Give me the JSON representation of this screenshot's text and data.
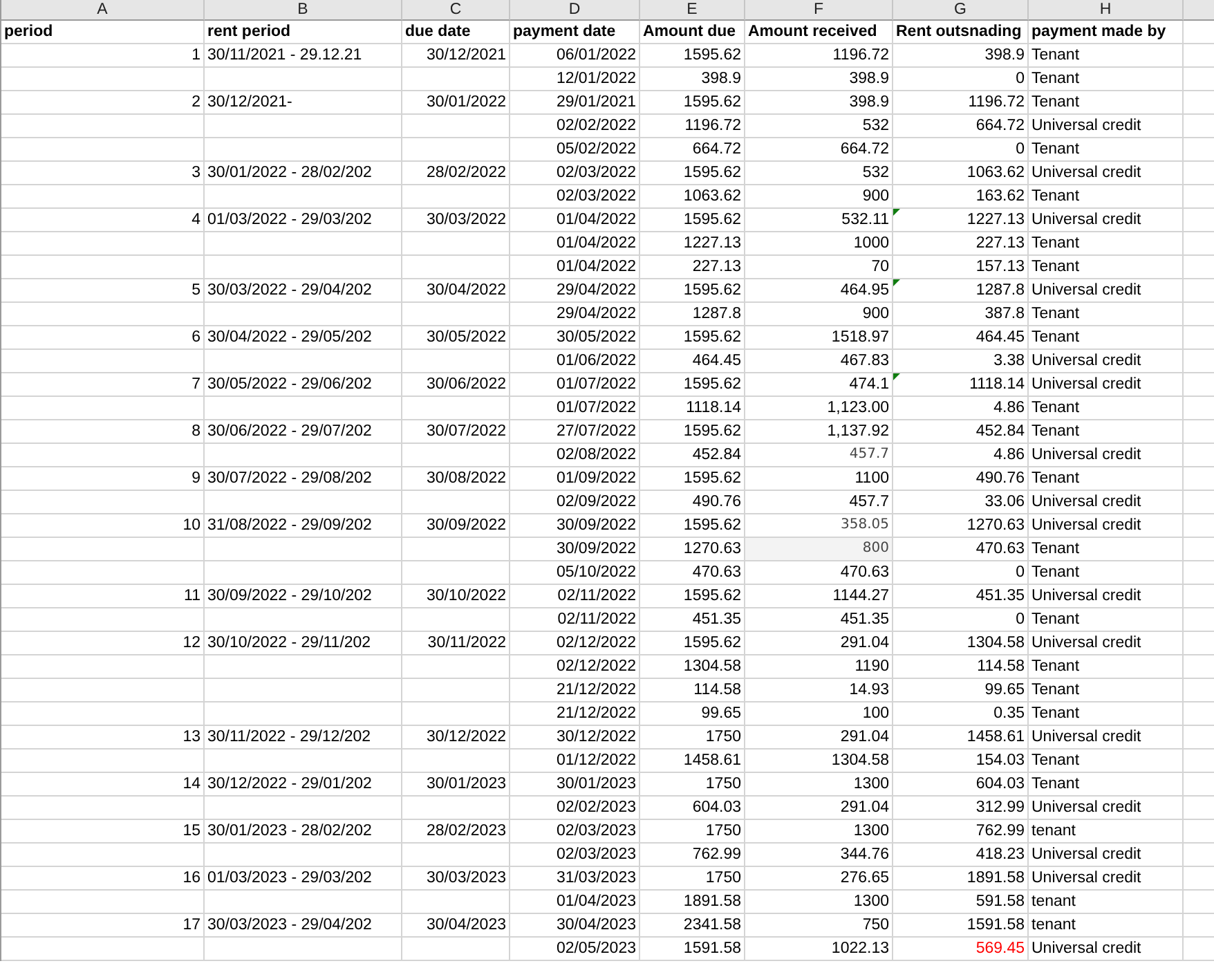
{
  "columns": [
    "A",
    "B",
    "C",
    "D",
    "E",
    "F",
    "G",
    "H"
  ],
  "headers": [
    "period",
    "rent period",
    "due date",
    "payment date",
    "Amount due",
    "Amount received",
    "Rent outsnading",
    "payment made by"
  ],
  "rows": [
    {
      "period": "1",
      "rent_period": "30/11/2021 - 29.12.21",
      "due_date": "30/12/2021",
      "payment_date": "06/01/2022",
      "amount_due": "1595.62",
      "amount_received": "1196.72",
      "outstanding": "398.9",
      "paid_by": "Tenant",
      "flagged": false
    },
    {
      "payment_date": "12/01/2022",
      "amount_due": "398.9",
      "amount_received": "398.9",
      "outstanding": "0",
      "paid_by": "Tenant",
      "flagged": false
    },
    {
      "period": "2",
      "rent_period": "30/12/2021-",
      "due_date": "30/01/2022",
      "payment_date": "29/01/2021",
      "amount_due": "1595.62",
      "amount_received": "398.9",
      "outstanding": "1196.72",
      "paid_by": "Tenant",
      "flagged": false
    },
    {
      "payment_date": "02/02/2022",
      "amount_due": "1196.72",
      "amount_received": "532",
      "outstanding": "664.72",
      "paid_by": "Universal credit",
      "flagged": false
    },
    {
      "payment_date": "05/02/2022",
      "amount_due": "664.72",
      "amount_received": "664.72",
      "outstanding": "0",
      "paid_by": "Tenant",
      "flagged": false
    },
    {
      "period": "3",
      "rent_period": "30/01/2022 - 28/02/202",
      "due_date": "28/02/2022",
      "payment_date": "02/03/2022",
      "amount_due": "1595.62",
      "amount_received": "532",
      "outstanding": "1063.62",
      "paid_by": "Universal credit",
      "flagged": false
    },
    {
      "payment_date": "02/03/2022",
      "amount_due": "1063.62",
      "amount_received": "900",
      "outstanding": "163.62",
      "paid_by": "Tenant",
      "flagged": false
    },
    {
      "period": "4",
      "rent_period": "01/03/2022 - 29/03/202",
      "due_date": "30/03/2022",
      "payment_date": "01/04/2022",
      "amount_due": "1595.62",
      "amount_received": "532.11",
      "outstanding": "1227.13",
      "paid_by": "Universal credit",
      "flagged": true
    },
    {
      "payment_date": "01/04/2022",
      "amount_due": "1227.13",
      "amount_received": "1000",
      "outstanding": "227.13",
      "paid_by": "Tenant",
      "flagged": false
    },
    {
      "payment_date": "01/04/2022",
      "amount_due": "227.13",
      "amount_received": "70",
      "outstanding": "157.13",
      "paid_by": "Tenant",
      "flagged": false
    },
    {
      "period": "5",
      "rent_period": "30/03/2022 - 29/04/202",
      "due_date": "30/04/2022",
      "payment_date": "29/04/2022",
      "amount_due": "1595.62",
      "amount_received": "464.95",
      "outstanding": "1287.8",
      "paid_by": "Universal credit",
      "flagged": true
    },
    {
      "payment_date": "29/04/2022",
      "amount_due": "1287.8",
      "amount_received": "900",
      "outstanding": "387.8",
      "paid_by": "Tenant",
      "flagged": false
    },
    {
      "period": "6",
      "rent_period": "30/04/2022 - 29/05/202",
      "due_date": "30/05/2022",
      "payment_date": "30/05/2022",
      "amount_due": "1595.62",
      "amount_received": "1518.97",
      "outstanding": "464.45",
      "paid_by": "Tenant",
      "flagged": false
    },
    {
      "payment_date": "01/06/2022",
      "amount_due": "464.45",
      "amount_received": "467.83",
      "outstanding": "3.38",
      "paid_by": "Universal credit",
      "flagged": false
    },
    {
      "period": "7",
      "rent_period": "30/05/2022 - 29/06/202",
      "due_date": "30/06/2022",
      "payment_date": "01/07/2022",
      "amount_due": "1595.62",
      "amount_received": "474.1",
      "outstanding": "1118.14",
      "paid_by": "Universal credit",
      "flagged": true
    },
    {
      "payment_date": "01/07/2022",
      "amount_due": "1118.14",
      "amount_received": "1,123.00",
      "outstanding": "4.86",
      "paid_by": "Tenant",
      "flagged": false
    },
    {
      "period": "8",
      "rent_period": "30/06/2022 - 29/07/202",
      "due_date": "30/07/2022",
      "payment_date": "27/07/2022",
      "amount_due": "1595.62",
      "amount_received": "1,137.92",
      "outstanding": "452.84",
      "paid_by": "Tenant",
      "flagged": false
    },
    {
      "payment_date": "02/08/2022",
      "amount_due": "452.84",
      "amount_received": "457.7",
      "received_plain": true,
      "outstanding": "4.86",
      "paid_by": "Universal credit",
      "flagged": false
    },
    {
      "period": "9",
      "rent_period": "30/07/2022 - 29/08/202",
      "due_date": "30/08/2022",
      "payment_date": "01/09/2022",
      "amount_due": "1595.62",
      "amount_received": "1100",
      "outstanding": "490.76",
      "paid_by": "Tenant",
      "flagged": false
    },
    {
      "payment_date": "02/09/2022",
      "amount_due": "490.76",
      "amount_received": "457.7",
      "outstanding": "33.06",
      "paid_by": "Universal credit",
      "flagged": false
    },
    {
      "period": "10",
      "rent_period": "31/08/2022 - 29/09/202",
      "due_date": "30/09/2022",
      "payment_date": "30/09/2022",
      "amount_due": "1595.62",
      "amount_received": "358.05",
      "received_plain": true,
      "outstanding": "1270.63",
      "paid_by": "Universal credit",
      "flagged": false
    },
    {
      "payment_date": "30/09/2022",
      "amount_due": "1270.63",
      "amount_received": "800",
      "received_plain": true,
      "received_shaded": true,
      "outstanding": "470.63",
      "paid_by": "Tenant",
      "flagged": false
    },
    {
      "payment_date": "05/10/2022",
      "amount_due": "470.63",
      "amount_received": "470.63",
      "outstanding": "0",
      "paid_by": "Tenant",
      "flagged": false
    },
    {
      "period": "11",
      "rent_period": "30/09/2022 - 29/10/202",
      "due_date": "30/10/2022",
      "payment_date": "02/11/2022",
      "amount_due": "1595.62",
      "amount_received": "1144.27",
      "outstanding": "451.35",
      "paid_by": "Universal credit",
      "flagged": false
    },
    {
      "payment_date": "02/11/2022",
      "amount_due": "451.35",
      "amount_received": "451.35",
      "outstanding": "0",
      "paid_by": "Tenant",
      "flagged": false
    },
    {
      "period": "12",
      "rent_period": "30/10/2022 - 29/11/202",
      "due_date": "30/11/2022",
      "payment_date": "02/12/2022",
      "amount_due": "1595.62",
      "amount_received": "291.04",
      "outstanding": "1304.58",
      "paid_by": "Universal credit",
      "flagged": false
    },
    {
      "payment_date": "02/12/2022",
      "amount_due": "1304.58",
      "amount_received": "1190",
      "outstanding": "114.58",
      "paid_by": "Tenant",
      "flagged": false
    },
    {
      "payment_date": "21/12/2022",
      "amount_due": "114.58",
      "amount_received": "14.93",
      "outstanding": "99.65",
      "paid_by": "Tenant",
      "flagged": false
    },
    {
      "payment_date": "21/12/2022",
      "amount_due": "99.65",
      "amount_received": "100",
      "outstanding": "0.35",
      "paid_by": "Tenant",
      "flagged": false
    },
    {
      "period": "13",
      "rent_period": "30/11/2022 - 29/12/202",
      "due_date": "30/12/2022",
      "payment_date": "30/12/2022",
      "amount_due": "1750",
      "amount_received": "291.04",
      "outstanding": "1458.61",
      "paid_by": "Universal credit",
      "flagged": false
    },
    {
      "payment_date": "01/12/2022",
      "amount_due": "1458.61",
      "amount_received": "1304.58",
      "outstanding": "154.03",
      "paid_by": "Tenant",
      "flagged": false
    },
    {
      "period": "14",
      "rent_period": "30/12/2022 - 29/01/202",
      "due_date": "30/01/2023",
      "payment_date": "30/01/2023",
      "amount_due": "1750",
      "amount_received": "1300",
      "outstanding": "604.03",
      "paid_by": "Tenant",
      "flagged": false
    },
    {
      "payment_date": "02/02/2023",
      "amount_due": "604.03",
      "amount_received": "291.04",
      "outstanding": "312.99",
      "paid_by": "Universal credit",
      "flagged": false
    },
    {
      "period": "15",
      "rent_period": "30/01/2023 - 28/02/202",
      "due_date": "28/02/2023",
      "payment_date": "02/03/2023",
      "amount_due": "1750",
      "amount_received": "1300",
      "outstanding": "762.99",
      "paid_by": "tenant",
      "flagged": false
    },
    {
      "payment_date": "02/03/2023",
      "amount_due": "762.99",
      "amount_received": "344.76",
      "outstanding": "418.23",
      "paid_by": "Universal credit",
      "flagged": false
    },
    {
      "period": "16",
      "rent_period": "01/03/2023 - 29/03/202",
      "due_date": "30/03/2023",
      "payment_date": "31/03/2023",
      "amount_due": "1750",
      "amount_received": "276.65",
      "outstanding": "1891.58",
      "paid_by": "Universal credit",
      "flagged": false
    },
    {
      "payment_date": "01/04/2023",
      "amount_due": "1891.58",
      "amount_received": "1300",
      "outstanding": "591.58",
      "paid_by": "tenant",
      "flagged": false
    },
    {
      "period": "17",
      "rent_period": "30/03/2023 - 29/04/202",
      "due_date": "30/04/2023",
      "payment_date": "30/04/2023",
      "amount_due": "2341.58",
      "amount_received": "750",
      "outstanding": "1591.58",
      "paid_by": "tenant",
      "flagged": false
    },
    {
      "payment_date": "02/05/2023",
      "amount_due": "1591.58",
      "amount_received": "1022.13",
      "outstanding": "569.45",
      "color": "#ff0000",
      "paid_by": "Universal credit",
      "flagged": false
    }
  ]
}
